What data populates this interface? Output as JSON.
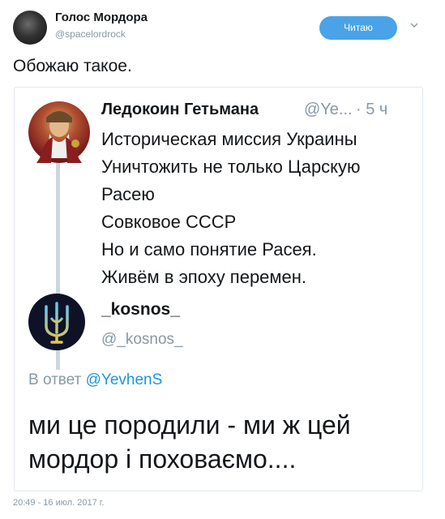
{
  "header": {
    "author_name": "Голос Мордора",
    "author_handle": "@spacelordrock",
    "follow_label": "Читаю"
  },
  "tweet": {
    "text": "Обожаю такое.",
    "timestamp": "20:49 - 16 июл. 2017 г."
  },
  "quoted": {
    "first": {
      "name": "Ледокоин Гетьмана",
      "handle": "@Ye...",
      "time": "· 5 ч",
      "lines": [
        "Историческая миссия Украины",
        "Уничтожить не только Царскую",
        "Расею",
        "Совковое СССР",
        "Но и само понятие Расея.",
        "Живём в эпоху перемен."
      ]
    },
    "reply": {
      "name": "_kosnos_",
      "handle": "@_kosnos_",
      "reply_prefix": "В ответ",
      "reply_mention": "@YevhenS",
      "text": "ми це породили - ми ж цей мордор і поховаємо...."
    }
  },
  "icons": {
    "chevron": "chevron-down-icon"
  },
  "colors": {
    "follow_button": "#4aa3e8",
    "mention": "#1b95e0",
    "muted": "#8899a6"
  }
}
